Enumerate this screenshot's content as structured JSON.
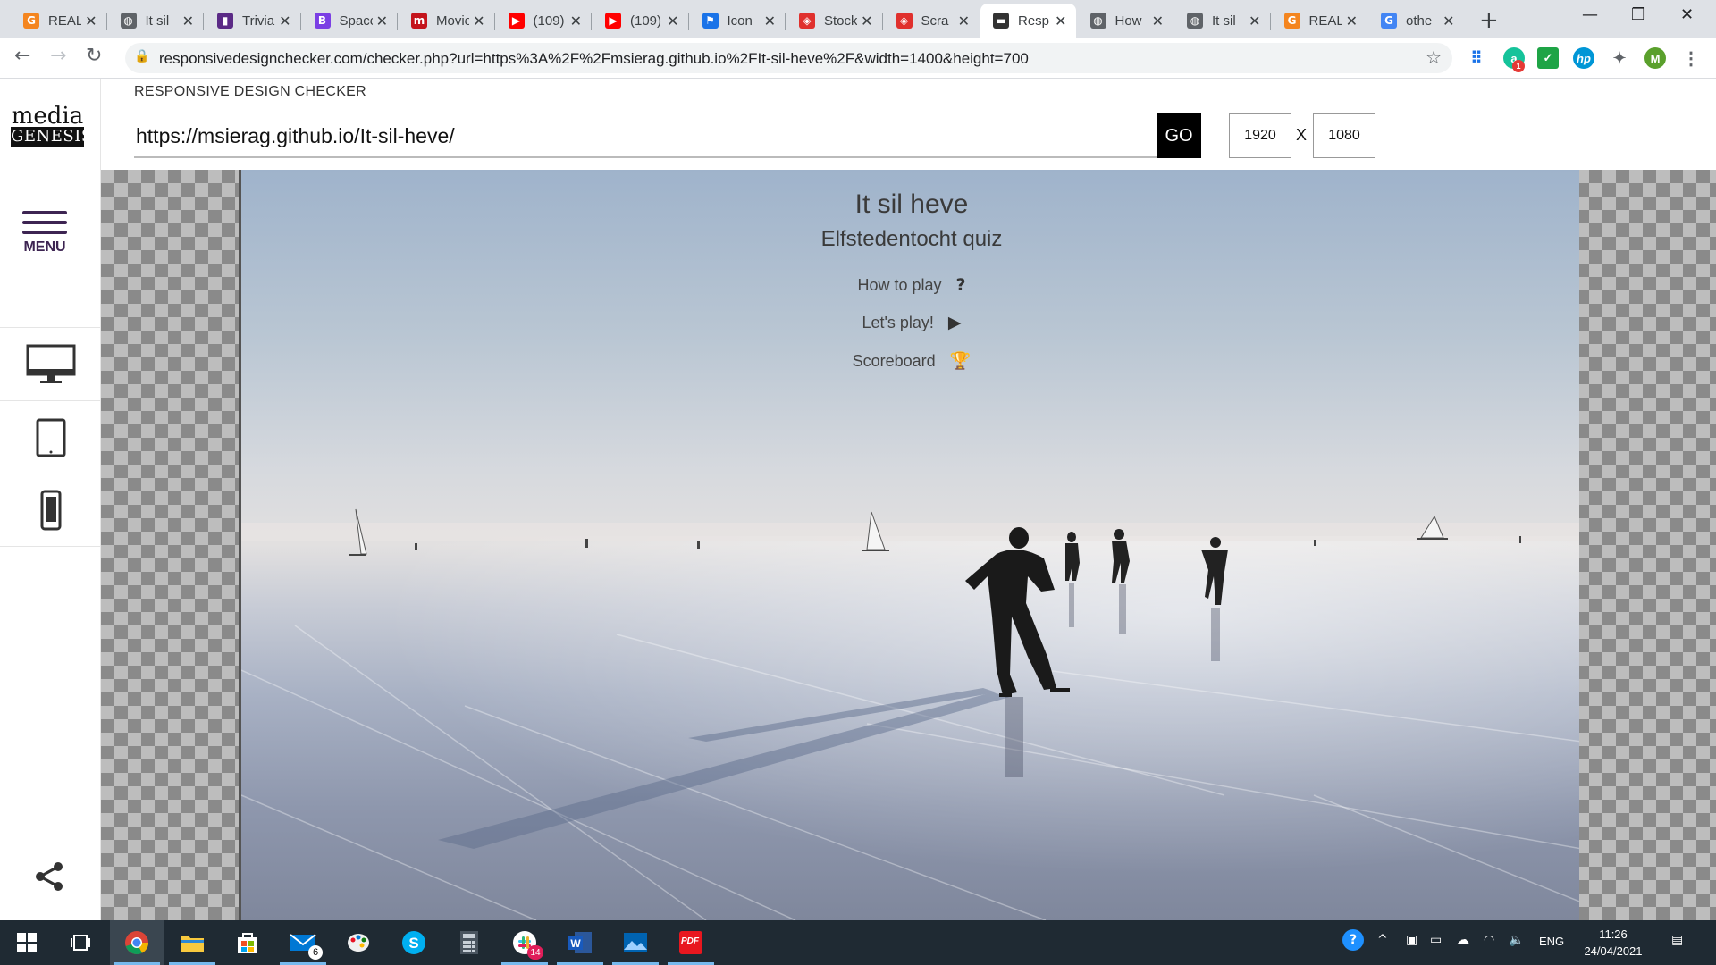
{
  "browser": {
    "tabs": [
      {
        "title": "REAL",
        "icon": "g-icon",
        "color": "#f4851f",
        "glyph": "G"
      },
      {
        "title": "It sil",
        "icon": "globe-icon",
        "color": "#5f6368",
        "glyph": "◍"
      },
      {
        "title": "Trivia",
        "icon": "trivia-icon",
        "color": "#5b2a86",
        "glyph": "▮"
      },
      {
        "title": "Space",
        "icon": "b-icon",
        "color": "#7b3fe4",
        "glyph": "B"
      },
      {
        "title": "Movie",
        "icon": "m-icon",
        "color": "#c4141c",
        "glyph": "m"
      },
      {
        "title": "(109)",
        "icon": "youtube-icon",
        "color": "#ff0000",
        "glyph": "▶"
      },
      {
        "title": "(109)",
        "icon": "youtube-icon",
        "color": "#ff0000",
        "glyph": "▶"
      },
      {
        "title": "Icon",
        "icon": "flag-icon",
        "color": "#1a73e8",
        "glyph": "⚑"
      },
      {
        "title": "Stock",
        "icon": "stock-icon",
        "color": "#e0302d",
        "glyph": "◈"
      },
      {
        "title": "Scra",
        "icon": "stock-icon",
        "color": "#e0302d",
        "glyph": "◈"
      },
      {
        "title": "Resp",
        "icon": "rdc-icon",
        "color": "#333333",
        "glyph": "▬",
        "active": true
      },
      {
        "title": "How",
        "icon": "globe-icon",
        "color": "#5f6368",
        "glyph": "◍"
      },
      {
        "title": "It sil",
        "icon": "globe-icon",
        "color": "#5f6368",
        "glyph": "◍"
      },
      {
        "title": "REAL",
        "icon": "g-icon",
        "color": "#f4851f",
        "glyph": "G"
      },
      {
        "title": "othe",
        "icon": "google-icon",
        "color": "#4285f4",
        "glyph": "G"
      }
    ],
    "close_glyph": "✕",
    "new_tab": "+",
    "url": "responsivedesignchecker.com/checker.php?url=https%3A%2F%2Fmsierag.github.io%2FIt-sil-heve%2F&width=1400&height=700",
    "profile_initial": "M",
    "grammarly_badge": "1"
  },
  "rdc": {
    "header": "RESPONSIVE DESIGN CHECKER",
    "logo_top": "media",
    "logo_bottom": "GENESIS",
    "menu_label": "MENU",
    "url_value": "https://msierag.github.io/It-sil-heve/",
    "go_label": "GO",
    "width": "1920",
    "height": "1080",
    "x_label": "X"
  },
  "site": {
    "title": "It sil heve",
    "subtitle": "Elfstedentocht quiz",
    "menu": [
      {
        "label": "How to play",
        "icon": "question-icon",
        "glyph": "?"
      },
      {
        "label": "Let's play!",
        "icon": "play-icon",
        "glyph": "▶"
      },
      {
        "label": "Scoreboard",
        "icon": "trophy-icon",
        "glyph": "🏆"
      }
    ]
  },
  "taskbar": {
    "mail_badge": "6",
    "slack_badge": "14",
    "language": "ENG",
    "time": "11:26",
    "date": "24/04/2021",
    "pdf_label": "PDF"
  }
}
